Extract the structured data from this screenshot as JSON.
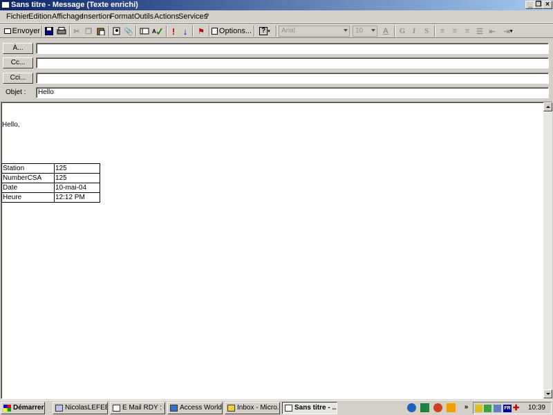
{
  "window": {
    "title": "Sans titre - Message (Texte enrichi)"
  },
  "menu": [
    "Fichier",
    "Edition",
    "Affichage",
    "Insertion",
    "Format",
    "Outils",
    "Actions",
    "Services",
    "?"
  ],
  "toolbar": {
    "send_label": "Envoyer",
    "options_label": "Options...",
    "font_name": "Arial",
    "font_size": "10",
    "bold_label": "G",
    "italic_label": "I",
    "underline_label": "S"
  },
  "header": {
    "to_label": "À...",
    "cc_label": "Cc...",
    "bcc_label": "Cci...",
    "subject_label": "Objet :",
    "to_value": "",
    "cc_value": "",
    "bcc_value": "",
    "subject_value": "Hello"
  },
  "body": {
    "greeting": "Hello,",
    "table": [
      [
        "Station",
        "125"
      ],
      [
        "NumberCSA",
        "125"
      ],
      [
        "Date",
        "10-mai-04"
      ],
      [
        "Heure",
        "12:12 PM"
      ]
    ]
  },
  "taskbar": {
    "start_label": "Démarrer",
    "tasks": [
      {
        "label": "NicolasLEFEB..."
      },
      {
        "label": "E Mail RDY : B..."
      },
      {
        "label": "Access World ..."
      },
      {
        "label": "Inbox - Micro..."
      },
      {
        "label": "Sans titre - ..."
      }
    ],
    "language": "FR",
    "clock": "10:39"
  },
  "colors": {
    "titlebar_start": "#0a246a",
    "titlebar_end": "#a6caf0",
    "face": "#d4d0c8"
  }
}
